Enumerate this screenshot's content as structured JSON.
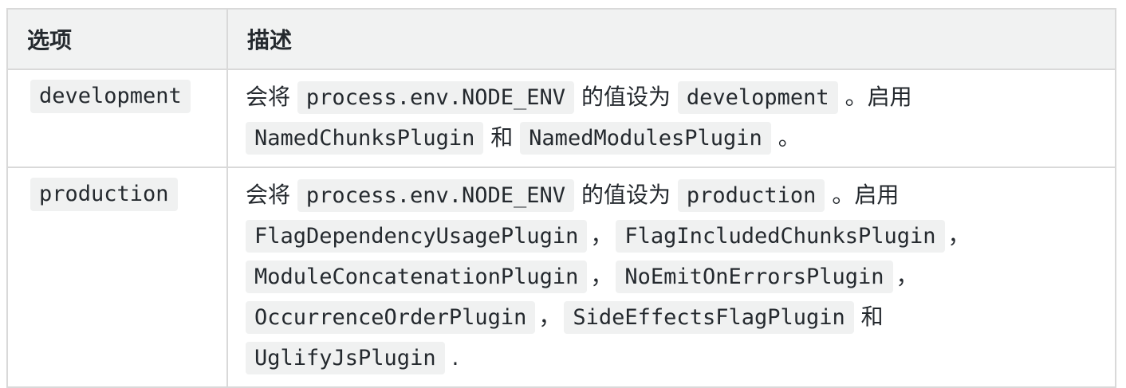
{
  "table": {
    "headers": {
      "option": "选项",
      "description": "描述"
    },
    "rows": [
      {
        "option": "development",
        "desc": {
          "t1": "会将",
          "env_var": "process.env.NODE_ENV",
          "t2": "的值设为",
          "value": "development",
          "t3": "。启用",
          "plugins": [
            "NamedChunksPlugin",
            "NamedModulesPlugin"
          ],
          "conj": "和",
          "end": "。"
        }
      },
      {
        "option": "production",
        "desc": {
          "t1": "会将",
          "env_var": "process.env.NODE_ENV",
          "t2": "的值设为",
          "value": "production",
          "t3": "。启用",
          "plugins": [
            "FlagDependencyUsagePlugin",
            "FlagIncludedChunksPlugin",
            "ModuleConcatenationPlugin",
            "NoEmitOnErrorsPlugin",
            "OccurrenceOrderPlugin",
            "SideEffectsFlagPlugin",
            "UglifyJsPlugin"
          ],
          "comma": "，",
          "conj": "和",
          "end": "."
        }
      }
    ]
  }
}
